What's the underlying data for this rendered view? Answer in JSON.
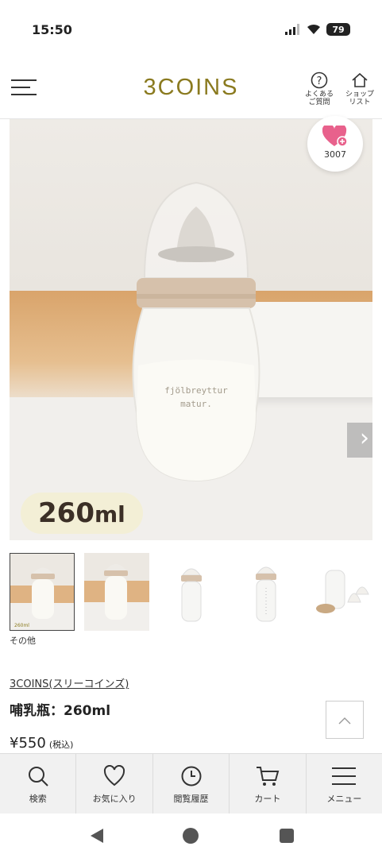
{
  "status": {
    "time": "15:50",
    "battery": "79"
  },
  "header": {
    "logo": "3COINS",
    "faq_label": "よくある\nご質問",
    "shop_label": "ショップ\nリスト"
  },
  "hero": {
    "size_label": "260",
    "size_unit": "ml",
    "bottle_print": "fjölbreyttur\nmatur.",
    "favorite_count": "3007"
  },
  "thumbnails": {
    "caption": "その他",
    "first_badge": "260ml",
    "count": 5
  },
  "product": {
    "brand": "3COINS(スリーコインズ)",
    "name": "哺乳瓶：260ml",
    "price": "¥550",
    "tax_note": "(税込)"
  },
  "bottom_nav": {
    "items": [
      {
        "label": "検索",
        "icon": "search-icon"
      },
      {
        "label": "お気に入り",
        "icon": "heart-icon"
      },
      {
        "label": "閲覧履歴",
        "icon": "clock-icon"
      },
      {
        "label": "カート",
        "icon": "cart-icon"
      },
      {
        "label": "メニュー",
        "icon": "menu-icon"
      }
    ]
  },
  "colors": {
    "logo": "#8a7a1f",
    "favorite": "#e8618c",
    "badge_bg": "#f3efd6"
  }
}
